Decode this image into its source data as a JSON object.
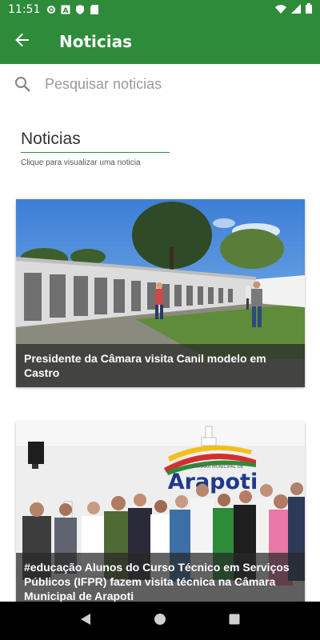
{
  "status_bar": {
    "time": "11:51",
    "icons": [
      "settings-icon",
      "font-icon",
      "shield-icon",
      "sd-card-icon"
    ],
    "right_icons": [
      "wifi-icon",
      "signal-icon",
      "battery-icon"
    ]
  },
  "app_bar": {
    "title": "Noticias",
    "back_icon": "arrow-back-icon"
  },
  "search": {
    "placeholder": "Pesquisar noticias",
    "value": ""
  },
  "section": {
    "title": "Noticias",
    "subtitle": "Clique para visualizar uma noticia"
  },
  "news": [
    {
      "title": "Presidente da Câmara visita Canil modelo em Castro"
    },
    {
      "title": "#educação Alunos do Curso Técnico em Serviços Públicos (IFPR) fazem visita técnica na Câmara Municipal de Arapoti",
      "image_logo_text": "Arapoti",
      "image_logo_subtext": "CÂMARA MUNICIPAL DE"
    }
  ],
  "nav_bar": {
    "buttons": [
      "back-triangle-icon",
      "home-circle-icon",
      "recents-square-icon"
    ]
  },
  "colors": {
    "primary": "#2e8b3a"
  }
}
